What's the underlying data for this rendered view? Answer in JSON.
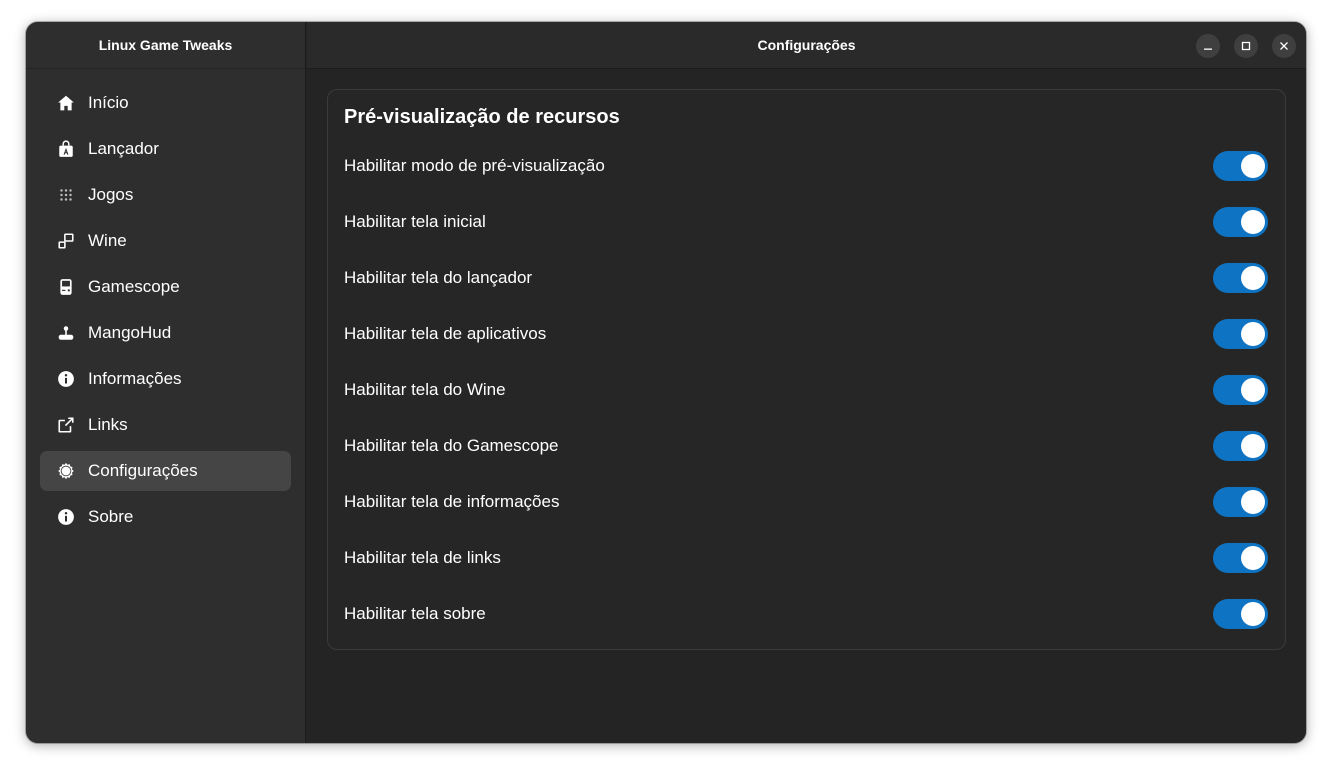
{
  "sidebar": {
    "title": "Linux Game Tweaks",
    "items": [
      {
        "label": "Início",
        "icon": "home-icon"
      },
      {
        "label": "Lançador",
        "icon": "bag-icon"
      },
      {
        "label": "Jogos",
        "icon": "grid-icon"
      },
      {
        "label": "Wine",
        "icon": "windows-icon"
      },
      {
        "label": "Gamescope",
        "icon": "gameboy-icon"
      },
      {
        "label": "MangoHud",
        "icon": "joystick-icon"
      },
      {
        "label": "Informações",
        "icon": "info-icon"
      },
      {
        "label": "Links",
        "icon": "external-link-icon"
      },
      {
        "label": "Configurações",
        "icon": "gear-icon",
        "active": true
      },
      {
        "label": "Sobre",
        "icon": "info-icon"
      }
    ]
  },
  "header": {
    "title": "Configurações",
    "controls": [
      "minimize-icon",
      "maximize-icon",
      "close-icon"
    ]
  },
  "main": {
    "section_title": "Pré-visualização de recursos",
    "toggles": [
      {
        "label": "Habilitar modo de pré-visualização",
        "on": true
      },
      {
        "label": "Habilitar tela inicial",
        "on": true
      },
      {
        "label": "Habilitar tela do lançador",
        "on": true
      },
      {
        "label": "Habilitar tela de aplicativos",
        "on": true
      },
      {
        "label": "Habilitar tela do Wine",
        "on": true
      },
      {
        "label": "Habilitar tela do Gamescope",
        "on": true
      },
      {
        "label": "Habilitar tela de informações",
        "on": true
      },
      {
        "label": "Habilitar tela de links",
        "on": true
      },
      {
        "label": "Habilitar tela sobre",
        "on": true
      }
    ]
  },
  "colors": {
    "accent": "#0e73c2",
    "sidebar_bg": "#2e2e2e",
    "content_bg": "#242424",
    "active_item_bg": "#454545"
  }
}
